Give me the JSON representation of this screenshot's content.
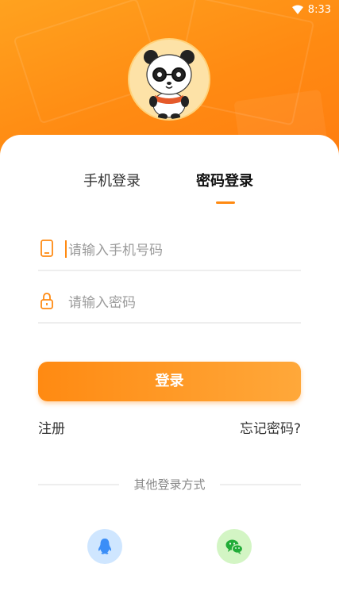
{
  "status_bar": {
    "time": "8:33",
    "icons": [
      "wifi-icon"
    ]
  },
  "avatar": {
    "icon": "panda-mascot-icon"
  },
  "tabs": [
    {
      "label": "手机登录",
      "active": false
    },
    {
      "label": "密码登录",
      "active": true
    }
  ],
  "form": {
    "phone": {
      "value": "",
      "placeholder": "请输入手机号码",
      "icon": "phone-icon"
    },
    "password": {
      "value": "",
      "placeholder": "请输入密码",
      "icon": "lock-icon"
    }
  },
  "actions": {
    "login_label": "登录",
    "register_label": "注册",
    "forgot_label": "忘记密码?"
  },
  "other_login": {
    "label": "其他登录方式",
    "methods": [
      {
        "name": "QQ",
        "icon": "qq-icon",
        "color": "#3b8ef7"
      },
      {
        "name": "WeChat",
        "icon": "wechat-icon",
        "color": "#22ac38"
      }
    ]
  },
  "colors": {
    "accent": "#ff8a12",
    "accent_light": "#ffa83a"
  }
}
